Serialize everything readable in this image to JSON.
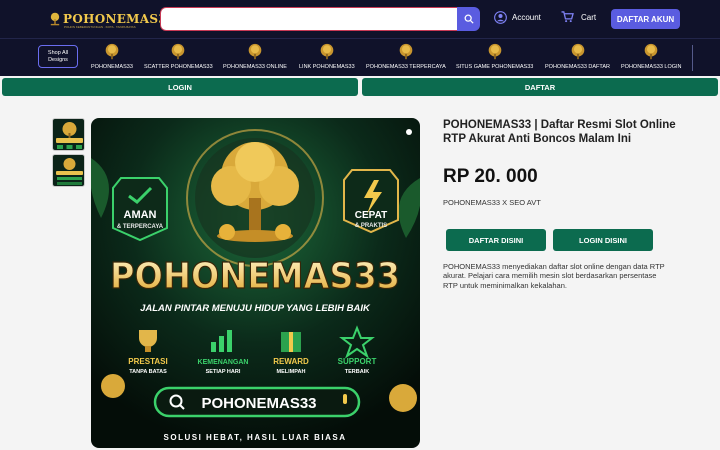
{
  "header": {
    "logo_text": "POHONEMAS33",
    "logo_tagline": "POHON KEBERUNTUNGAN · KOTA · TANPA BATAS",
    "search": {
      "value": "",
      "placeholder": ""
    },
    "account_label": "Account",
    "cart_label": "Cart",
    "daftar_akun_label": "DAFTAR AKUN"
  },
  "nav": {
    "shop_all_label": "Shop All Designs",
    "items": [
      {
        "label": "POHONEMAS33"
      },
      {
        "label": "SCATTER POHONEMAS33"
      },
      {
        "label": "POHONEMAS33 ONLINE"
      },
      {
        "label": "LINK POHONEMAS33"
      },
      {
        "label": "POHONEMAS33 TERPERCAYA"
      },
      {
        "label": "SITUS GAME POHONEMAS33"
      },
      {
        "label": "POHONEMAS33 DAFTAR"
      },
      {
        "label": "POHONEMAS33 LOGIN"
      }
    ]
  },
  "tabs": {
    "login_label": "LOGIN",
    "daftar_label": "DAFTAR"
  },
  "banner": {
    "badge_left_title": "AMAN",
    "badge_left_sub": "& TERPERCAYA",
    "badge_right_title": "CEPAT",
    "badge_right_sub": "& PRAKTIS",
    "brand": "POHONEMAS33",
    "tagline": "JALAN PINTAR MENUJU HIDUP YANG LEBIH BAIK",
    "features": [
      {
        "title": "PRESTASI",
        "sub": "TANPA BATAS"
      },
      {
        "title": "KEMENANGAN",
        "sub": "SETIAP HARI"
      },
      {
        "title": "REWARD",
        "sub": "MELIMPAH"
      },
      {
        "title": "SUPPORT",
        "sub": "TERBAIK"
      }
    ],
    "search_text": "POHONEMAS33",
    "footer": "SOLUSI HEBAT, HASIL LUAR BIASA"
  },
  "product": {
    "title": "POHONEMAS33 | Daftar Resmi Slot Online RTP Akurat Anti Boncos Malam Ini",
    "price": "RP 20. 000",
    "vendor": "POHONEMAS33 X SEO AVT",
    "daftar_label": "DAFTAR DISINI",
    "login_label": "LOGIN DISINI",
    "description": "POHONEMAS33 menyediakan daftar slot online dengan data RTP akurat. Pelajari cara memilih mesin slot berdasarkan persentase RTP untuk meminimalkan kekalahan."
  },
  "colors": {
    "header_bg": "#10122a",
    "accent": "#5a5ce0",
    "green": "#0c6b4f",
    "gold": "#f2c94c"
  },
  "icons": [
    "tree-icon",
    "search-icon",
    "user-icon",
    "cart-icon"
  ]
}
